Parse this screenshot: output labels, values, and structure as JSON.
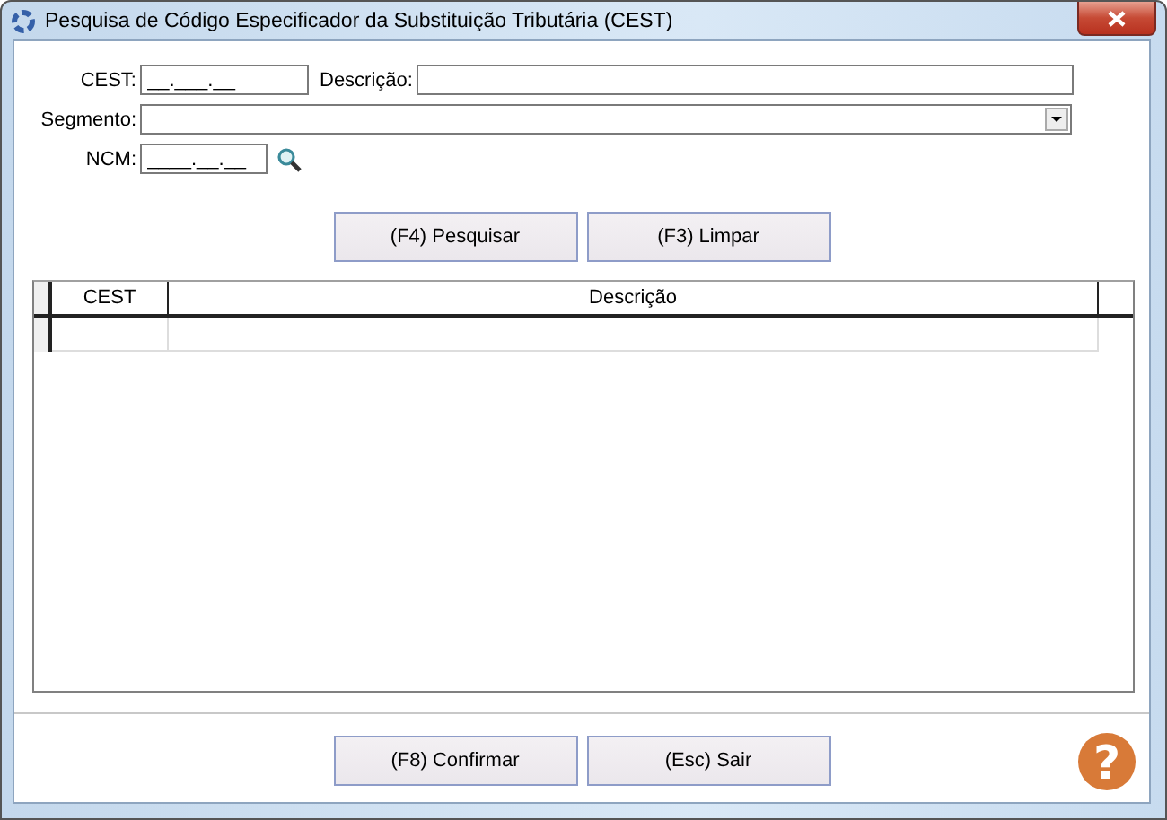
{
  "window": {
    "title": "Pesquisa de Código Especificador da Substituição Tributária (CEST)"
  },
  "form": {
    "cest": {
      "label": "CEST:",
      "value": "__.___.__"
    },
    "descricao": {
      "label": "Descrição:"
    },
    "segmento": {
      "label": "Segmento:"
    },
    "ncm": {
      "label": "NCM:",
      "value": "____.__.__"
    }
  },
  "search_buttons": [
    "(F4) Pesquisar",
    "(F3) Limpar"
  ],
  "table": {
    "columns": [
      "CEST",
      "Descrição"
    ]
  },
  "footer_buttons": [
    "(F8) Confirmar",
    "(Esc) Sair"
  ],
  "help": {
    "icon": "?"
  }
}
